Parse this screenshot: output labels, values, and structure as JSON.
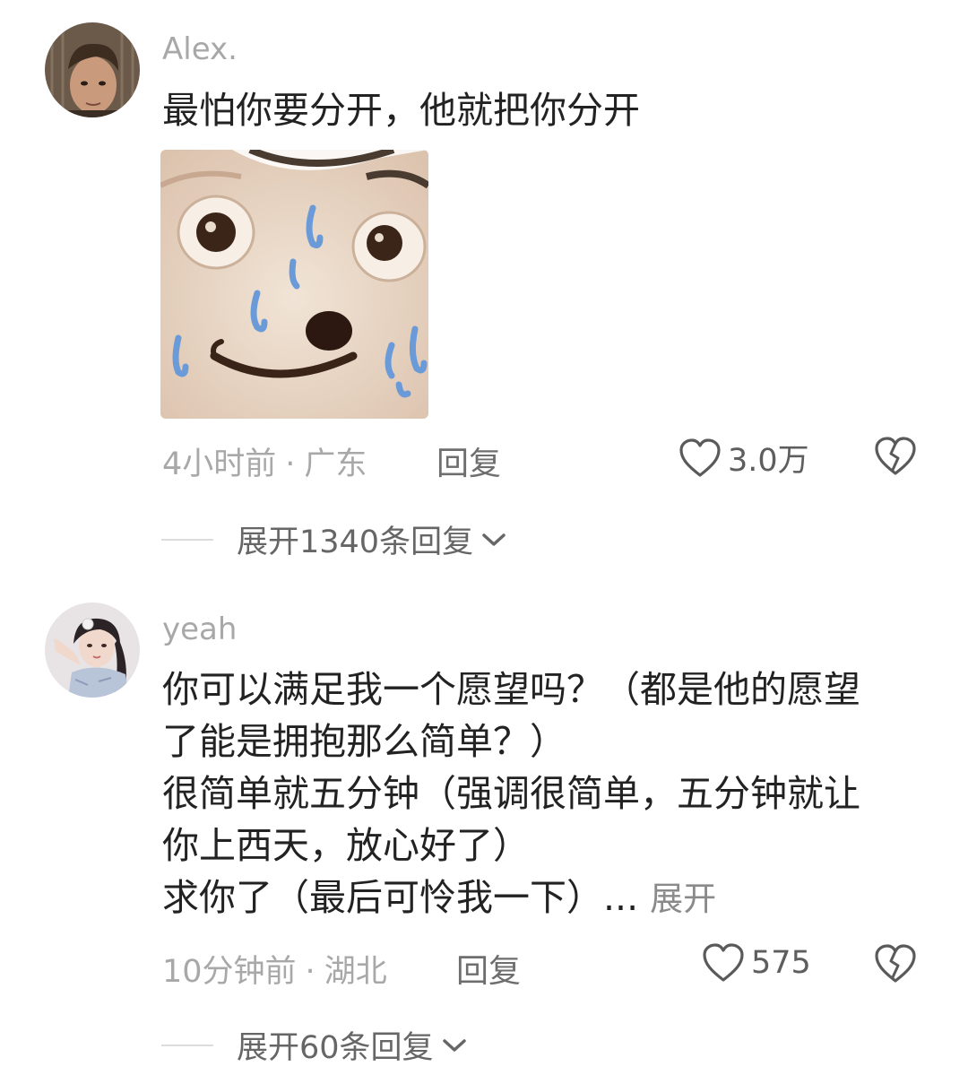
{
  "comments": [
    {
      "username": "Alex.",
      "text_lines": [
        "最怕你要分开，他就把你分开"
      ],
      "sticker": "sweating-dog-meme-sticker",
      "time": "4小时前",
      "location": "广东",
      "separator": "·",
      "reply_label": "回复",
      "likes": "3.0万",
      "expand_label": "展开1340条回复"
    },
    {
      "username": "yeah",
      "text_lines": [
        "你可以满足我一个愿望吗？（都是他的愿望",
        "了能是拥抱那么简单？）",
        "很简单就五分钟（强调很简单，五分钟就让",
        "你上西天，放心好了）",
        "求你了（最后可怜我一下）..."
      ],
      "expand_inline_label": "展开",
      "time": "10分钟前",
      "location": "湖北",
      "separator": "·",
      "reply_label": "回复",
      "likes": "575",
      "expand_label": "展开60条回复"
    }
  ],
  "icons": {
    "like": "heart-outline-icon",
    "dislike": "broken-heart-icon",
    "expand": "chevron-down-icon"
  },
  "colors": {
    "meta_gray": "#a8a8a8",
    "text": "#222222",
    "sweat_blue": "#6a9bd8"
  }
}
